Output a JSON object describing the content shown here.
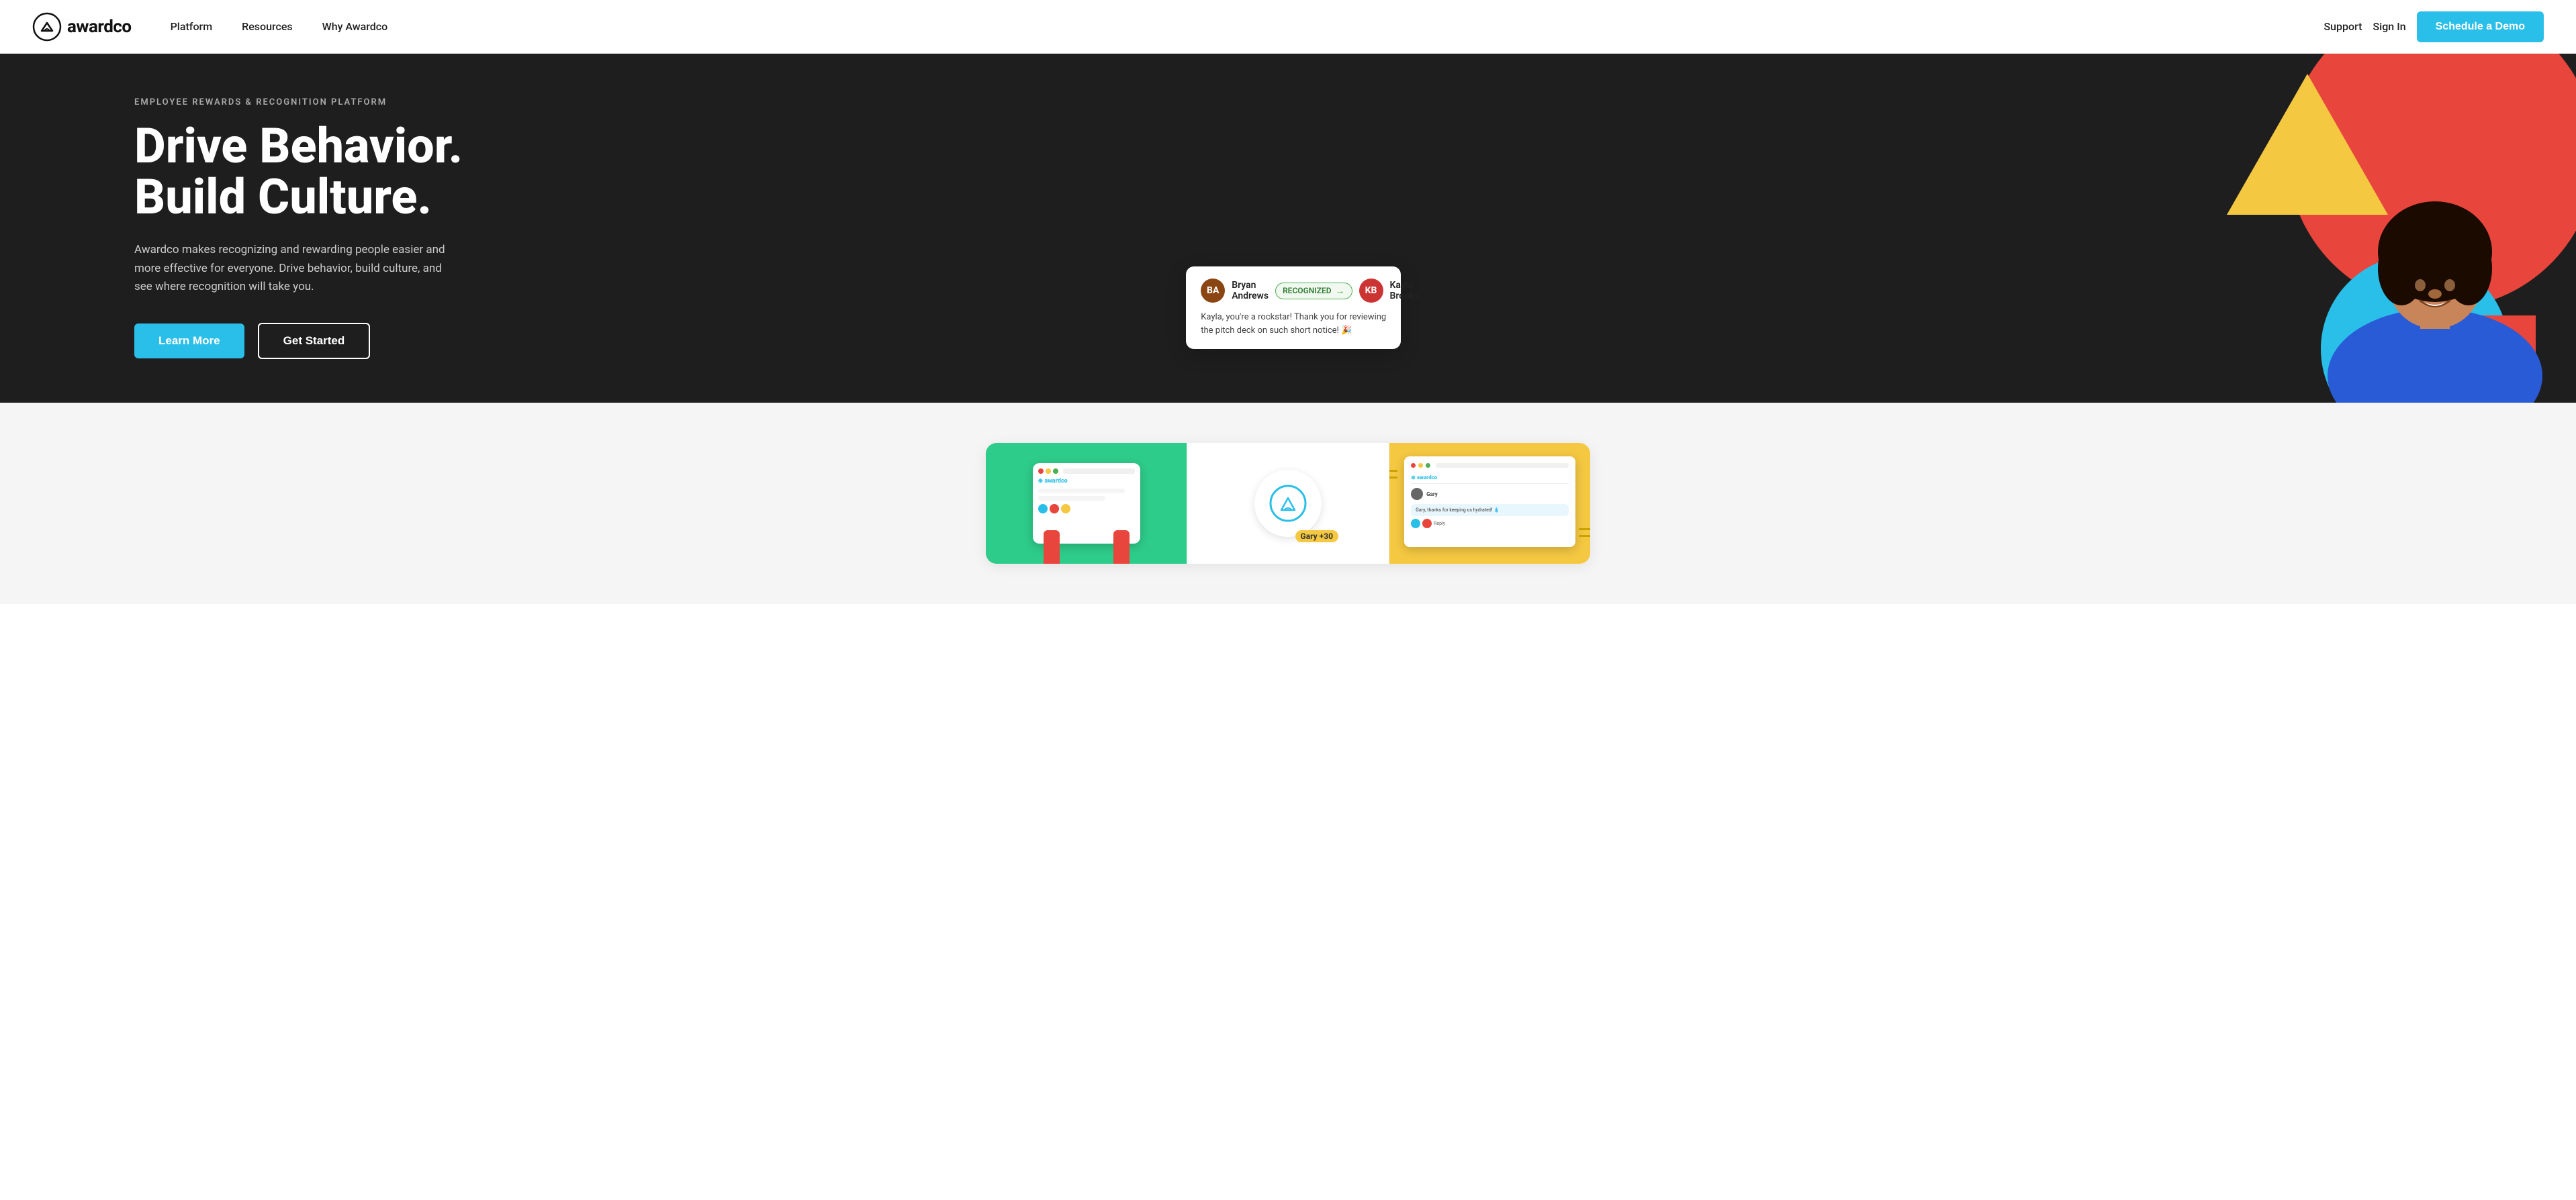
{
  "brand": {
    "name": "awardco",
    "logo_symbol": "⊛"
  },
  "nav": {
    "links_left": [
      {
        "id": "platform",
        "label": "Platform"
      },
      {
        "id": "resources",
        "label": "Resources"
      },
      {
        "id": "why-awardco",
        "label": "Why Awardco"
      }
    ],
    "links_right": [
      {
        "id": "support",
        "label": "Support"
      },
      {
        "id": "sign-in",
        "label": "Sign In"
      }
    ],
    "cta_label": "Schedule a Demo"
  },
  "hero": {
    "eyebrow": "EMPLOYEE REWARDS & RECOGNITION PLATFORM",
    "title_line1": "Drive Behavior.",
    "title_line2": "Build Culture.",
    "description": "Awardco makes recognizing and rewarding people easier and more effective for everyone. Drive behavior, build culture, and see where recognition will take you.",
    "btn_primary": "Learn More",
    "btn_secondary": "Get Started"
  },
  "recognition_card": {
    "sender_name": "Bryan Andrews",
    "badge_label": "RECOGNIZED",
    "receiver_name": "Kayla Brooks",
    "message": "Kayla, you're a rockstar! Thank you for reviewing the pitch deck on such short notice! 🎉"
  },
  "bottom_section": {
    "cards": [
      {
        "id": "card-green",
        "color": "#2ecc8a"
      },
      {
        "id": "card-white",
        "color": "#ffffff"
      },
      {
        "id": "card-yellow",
        "color": "#f5c842"
      }
    ]
  }
}
